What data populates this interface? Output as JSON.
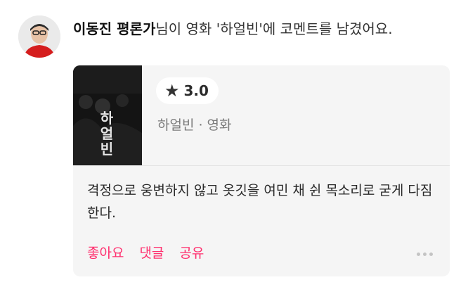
{
  "post": {
    "author": "이동진 평론가",
    "action_text": "님이 영화 '하얼빈'에 코멘트를 남겼어요.",
    "rating": "3.0",
    "movie_meta": "하얼빈 · 영화",
    "poster_title": "하\n얼\n빈",
    "comment": "격정으로 웅변하지 않고 옷깃을 여민 채 쉰 목소리로 굳게 다짐한다.",
    "actions": {
      "like": "좋아요",
      "comment": "댓글",
      "share": "공유"
    }
  },
  "icons": {
    "star": "star-icon",
    "more": "more-icon"
  },
  "colors": {
    "accent": "#ff2f6e",
    "card_bg": "#f5f5f5",
    "poster_bg": "#141414"
  }
}
